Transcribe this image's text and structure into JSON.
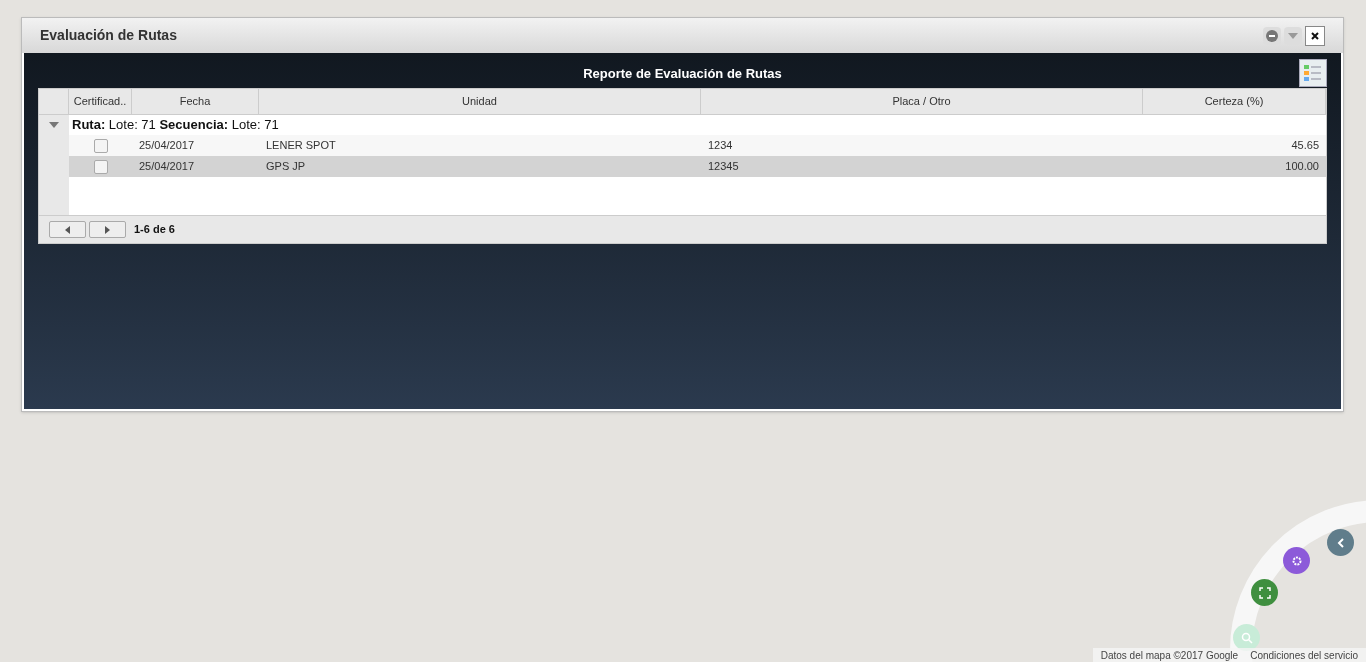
{
  "window": {
    "title": "Evaluación de Rutas"
  },
  "report": {
    "title": "Reporte de Evaluación de Rutas"
  },
  "table": {
    "columns": [
      "Certificad..",
      "Fecha",
      "Unidad",
      "Placa / Otro",
      "Certeza (%)"
    ],
    "group": {
      "label": "**Ruta:** Lote: 71 **Secuencia:** Lote: 71",
      "expanded": true
    },
    "rows": [
      {
        "checked": false,
        "selected": false,
        "cells": [
          "25/04/2017",
          "LENER SPOT",
          "1234",
          "45.65"
        ]
      },
      {
        "checked": false,
        "selected": true,
        "cells": [
          "25/04/2017",
          "GPS JP",
          "12345",
          "100.00"
        ]
      }
    ],
    "pager": "1-6 de 6"
  },
  "map": {
    "attribution": "Datos del mapa ©2017 Google",
    "terms": "Condiciones del servicio"
  }
}
